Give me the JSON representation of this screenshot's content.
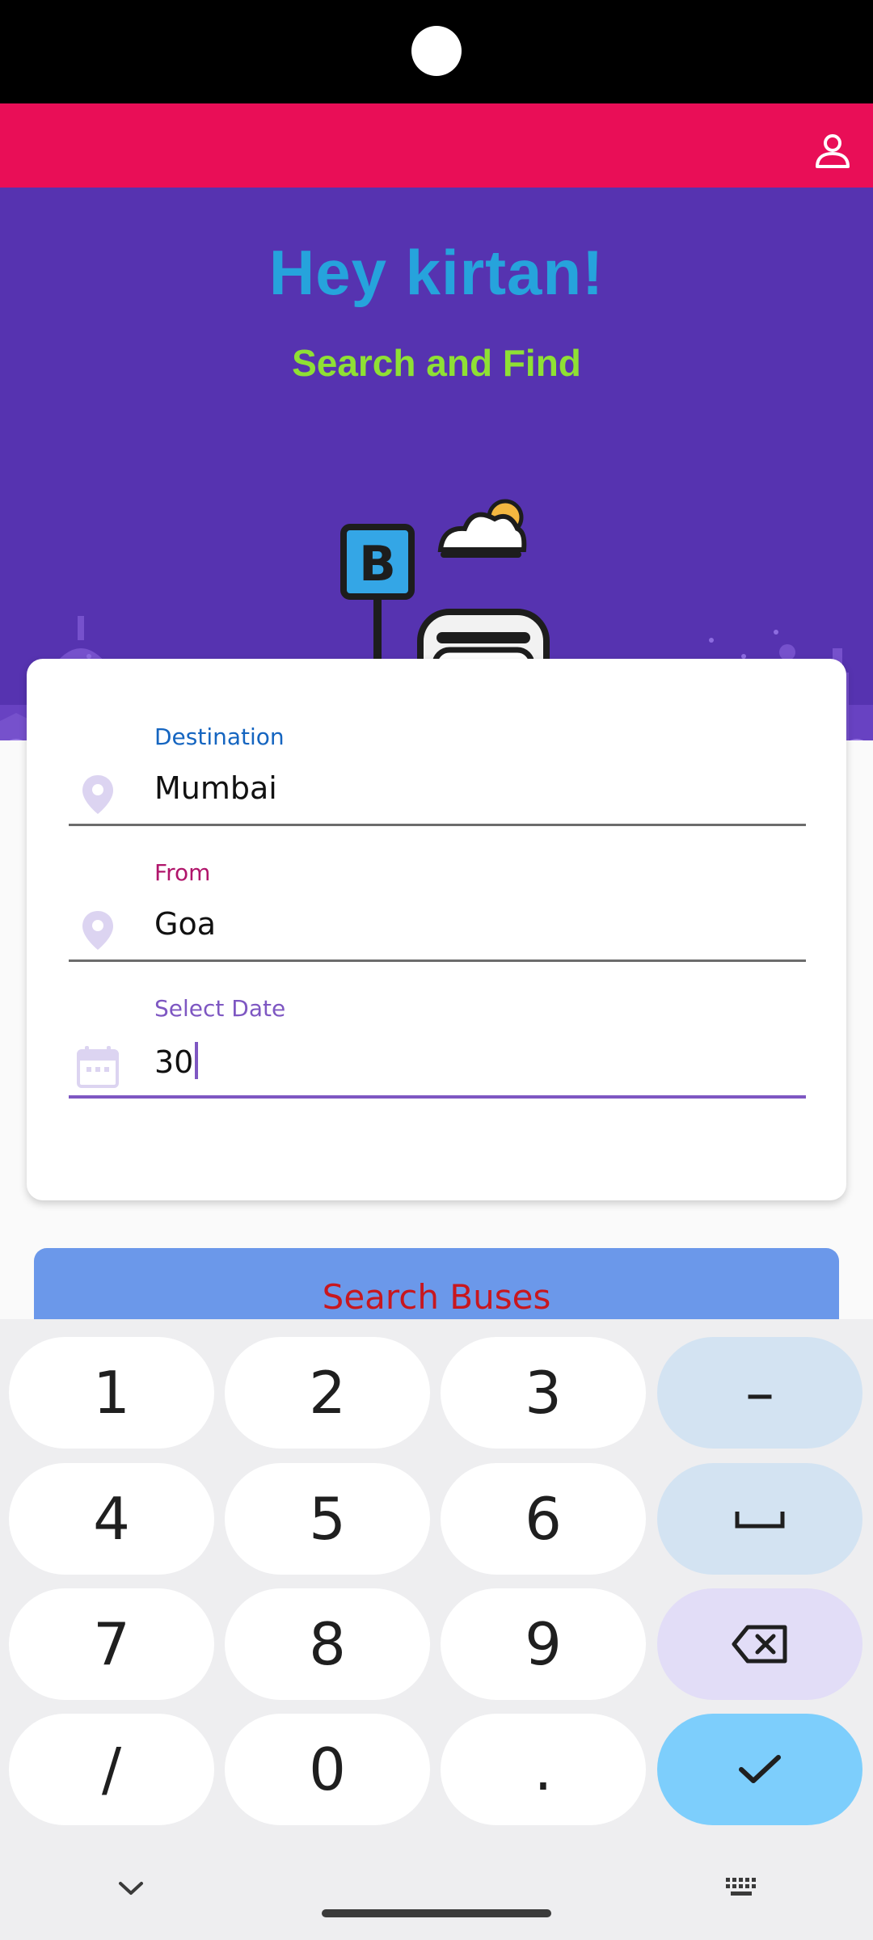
{
  "app_bar": {
    "profile_icon": "person-outline-icon",
    "background": "#E90E57"
  },
  "hero": {
    "greeting": "Hey kirtan!",
    "subtitle": "Search and Find",
    "illustration_sign_letter": "B",
    "background": "#5633B0"
  },
  "form": {
    "destination": {
      "label": "Destination",
      "value": "Mumbai",
      "icon": "location-pin-icon"
    },
    "from": {
      "label": "From",
      "value": "Goa",
      "icon": "location-pin-icon"
    },
    "date": {
      "label": "Select Date",
      "value": "30",
      "icon": "calendar-icon"
    }
  },
  "search_button": {
    "label": "Search Buses"
  },
  "keyboard": {
    "rows": [
      [
        "1",
        "2",
        "3",
        "–"
      ],
      [
        "4",
        "5",
        "6",
        "␣"
      ],
      [
        "7",
        "8",
        "9",
        "⌫"
      ],
      [
        "/",
        "0",
        ".",
        "✓"
      ]
    ],
    "bottom_left_icon": "chevron-down-icon",
    "bottom_right_icon": "keyboard-icon"
  }
}
